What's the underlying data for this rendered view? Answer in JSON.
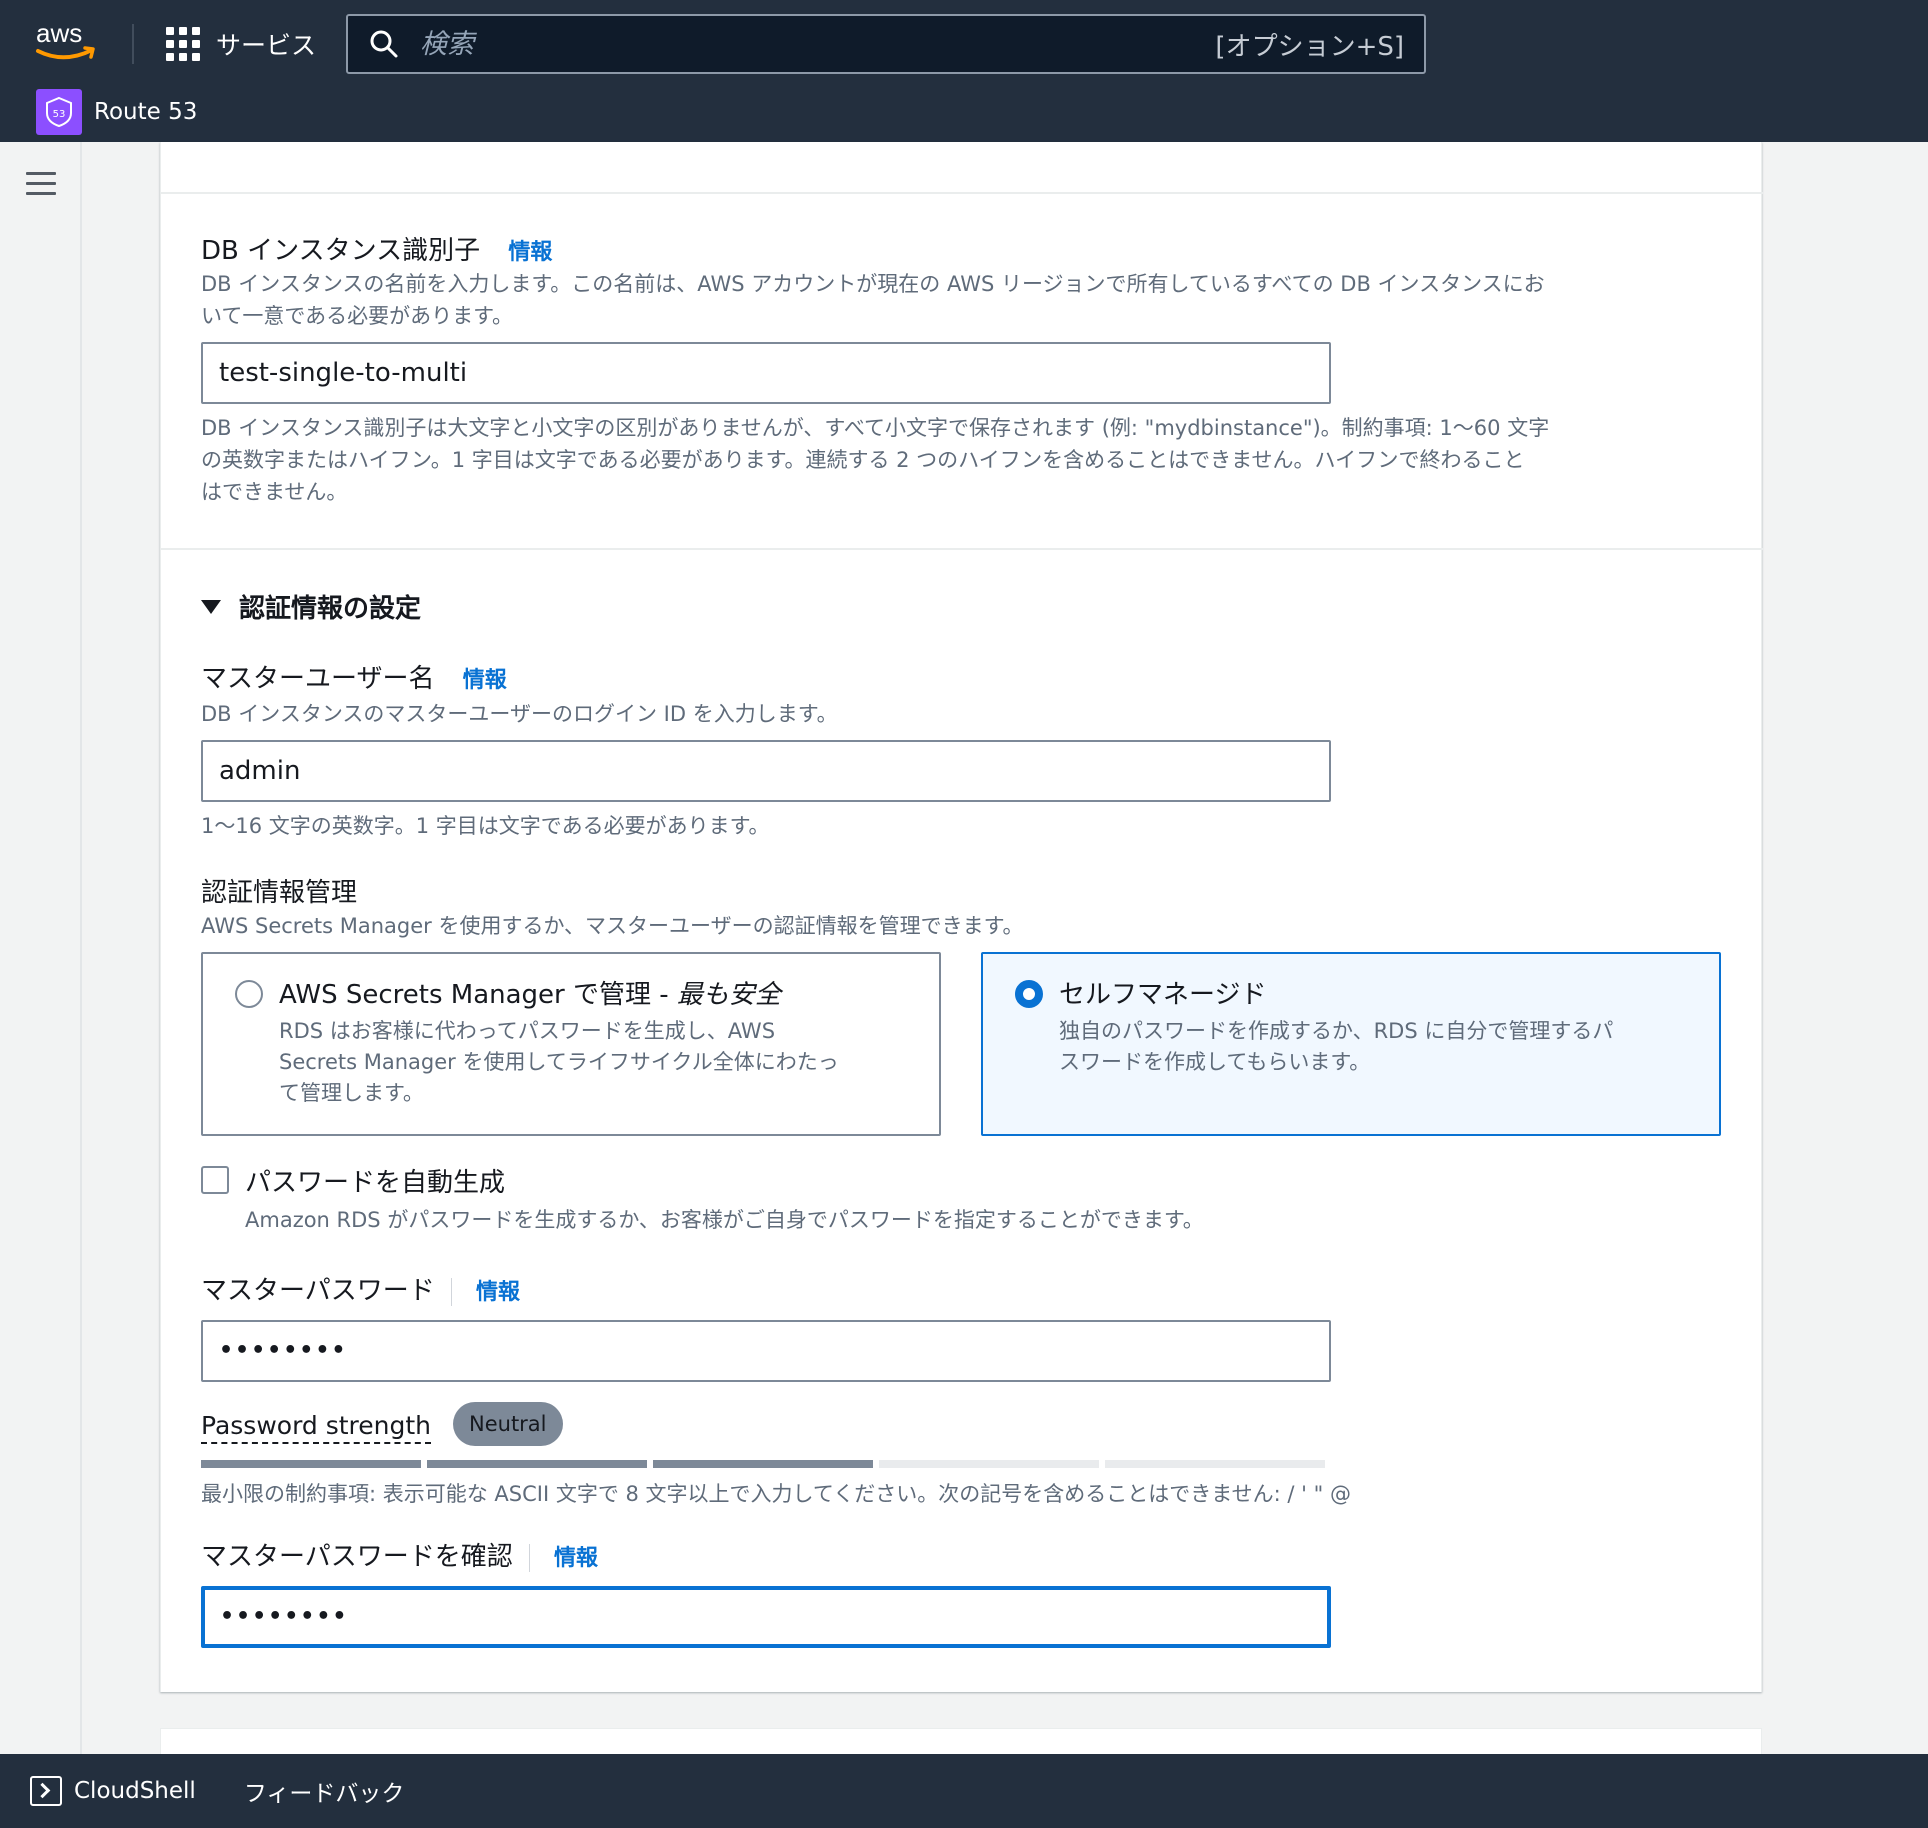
{
  "topbar": {
    "logo_text": "aws",
    "services_label": "サービス",
    "search_placeholder": "検索",
    "search_shortcut": "[オプション+S]",
    "service_name": "Route 53",
    "service_icon_text": "53"
  },
  "db_identifier": {
    "label": "DB インスタンス識別子",
    "info": "情報",
    "description_line1": "DB インスタンスの名前を入力します。この名前は、AWS アカウントが現在の AWS リージョンで所有しているすべての DB インスタンスにお",
    "description_line2": "いて一意である必要があります。",
    "value": "test-single-to-multi",
    "constraint_line1": "DB インスタンス識別子は大文字と小文字の区別がありませんが、すべて小文字で保存されます (例: \"mydbinstance\")。制約事項: 1〜60 文字",
    "constraint_line2": "の英数字またはハイフン。1 字目は文字である必要があります。連続する 2 つのハイフンを含めることはできません。ハイフンで終わること",
    "constraint_line3": "はできません。"
  },
  "credentials": {
    "section_title": "認証情報の設定",
    "master_username_label": "マスターユーザー名",
    "master_username_info": "情報",
    "master_username_desc": "DB インスタンスのマスターユーザーのログイン ID を入力します。",
    "master_username_value": "admin",
    "master_username_constraint": "1〜16 文字の英数字。1 字目は文字である必要があります。",
    "management_label": "認証情報管理",
    "management_desc": "AWS Secrets Manager を使用するか、マスターユーザーの認証情報を管理できます。",
    "option_secrets": {
      "title_prefix": "AWS Secrets Manager で管理 - ",
      "title_emphasis": "最も安全",
      "desc_line1": "RDS はお客様に代わってパスワードを生成し、AWS",
      "desc_line2": "Secrets Manager を使用してライフサイクル全体にわたっ",
      "desc_line3": "て管理します。",
      "selected": false
    },
    "option_self": {
      "title": "セルフマネージド",
      "desc_line1": "独自のパスワードを作成するか、RDS に自分で管理するパ",
      "desc_line2": "スワードを作成してもらいます。",
      "selected": true
    },
    "auto_generate_label": "パスワードを自動生成",
    "auto_generate_desc": "Amazon RDS がパスワードを生成するか、お客様がご自身でパスワードを指定することができます。",
    "auto_generate_checked": false,
    "master_password_label": "マスターパスワード",
    "master_password_info": "情報",
    "master_password_value": "••••••••",
    "password_strength_label": "Password strength",
    "password_strength_value": "Neutral",
    "password_strength_segments_filled": 3,
    "password_strength_segments_total": 5,
    "password_constraint": "最小限の制約事項: 表示可能な ASCII 文字で 8 文字以上で入力してください。次の記号を含めることはできません: / ' \" @",
    "confirm_password_label": "マスターパスワードを確認",
    "confirm_password_info": "情報",
    "confirm_password_value": "••••••••"
  },
  "bottombar": {
    "cloudshell_label": "CloudShell",
    "feedback_label": "フィードバック"
  },
  "colors": {
    "header_bg": "#232f3e",
    "link_blue": "#0972d3",
    "route53_purple": "#8c4fff",
    "aws_orange": "#ff9900",
    "strength_filled": "#7d8998",
    "strength_empty": "#e9ebed"
  },
  "icons": {
    "services": "grid-icon",
    "search": "search-icon",
    "route53": "route53-shield-icon",
    "menu": "hamburger-menu-icon",
    "section_toggle": "caret-down-icon",
    "cloudshell": "cloudshell-terminal-icon"
  }
}
